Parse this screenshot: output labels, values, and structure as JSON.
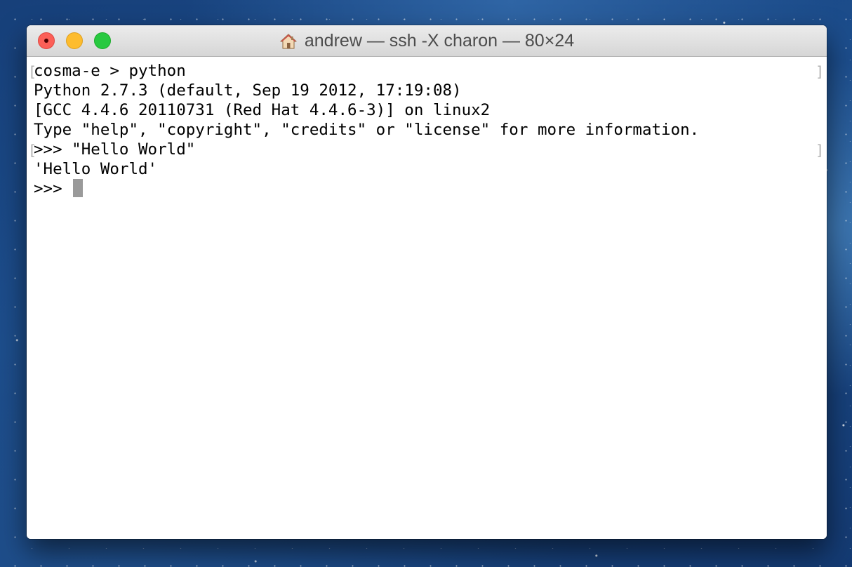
{
  "window": {
    "title": "andrew — ssh -X charon — 80×24",
    "title_icon": "home-icon"
  },
  "terminal": {
    "lines": [
      "cosma-e > python",
      "Python 2.7.3 (default, Sep 19 2012, 17:19:08)",
      "[GCC 4.4.6 20110731 (Red Hat 4.4.6-3)] on linux2",
      "Type \"help\", \"copyright\", \"credits\" or \"license\" for more information.",
      ">>> \"Hello World\"",
      "'Hello World'",
      ">>> "
    ],
    "mark_open": "[",
    "mark_close": "]"
  },
  "colors": {
    "close": "#fc5f57",
    "minimize": "#fdbc2e",
    "zoom": "#28c940",
    "cursor": "#9a9a9a"
  }
}
